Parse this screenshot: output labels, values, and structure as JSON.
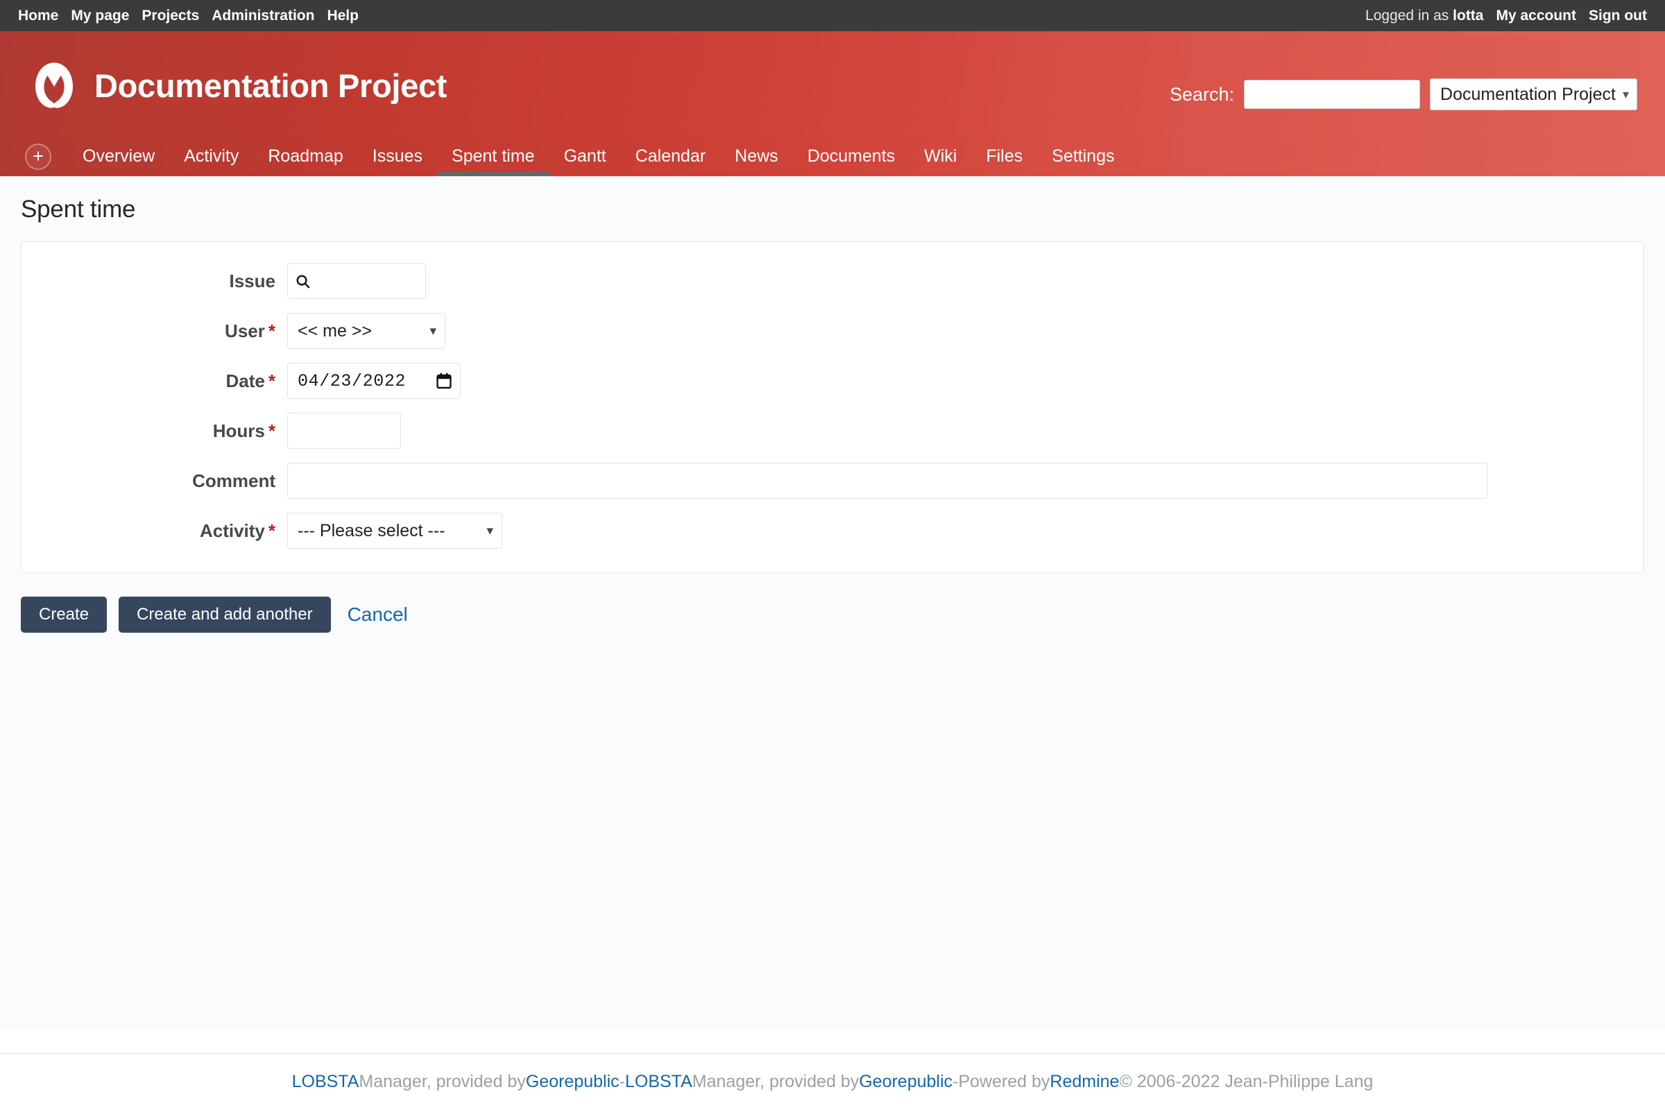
{
  "top_menu": {
    "left_items": [
      {
        "label": "Home",
        "name": "top-menu-home"
      },
      {
        "label": "My page",
        "name": "top-menu-my-page"
      },
      {
        "label": "Projects",
        "name": "top-menu-projects"
      },
      {
        "label": "Administration",
        "name": "top-menu-administration"
      },
      {
        "label": "Help",
        "name": "top-menu-help"
      }
    ],
    "logged_in_prefix": "Logged in as",
    "username": "lotta",
    "my_account": "My account",
    "sign_out": "Sign out"
  },
  "header": {
    "project_title": "Documentation Project",
    "logo_icon": "redmine-m-logo-icon",
    "search_label": "Search:",
    "search_value": "",
    "search_placeholder": "",
    "project_selector_value": "Documentation Project",
    "chevron_icon": "chevron-down-icon"
  },
  "main_menu": {
    "add_button_label": "+",
    "items": [
      {
        "label": "Overview",
        "name": "nav-overview",
        "selected": false
      },
      {
        "label": "Activity",
        "name": "nav-activity",
        "selected": false
      },
      {
        "label": "Roadmap",
        "name": "nav-roadmap",
        "selected": false
      },
      {
        "label": "Issues",
        "name": "nav-issues",
        "selected": false
      },
      {
        "label": "Spent time",
        "name": "nav-spent-time",
        "selected": true
      },
      {
        "label": "Gantt",
        "name": "nav-gantt",
        "selected": false
      },
      {
        "label": "Calendar",
        "name": "nav-calendar",
        "selected": false
      },
      {
        "label": "News",
        "name": "nav-news",
        "selected": false
      },
      {
        "label": "Documents",
        "name": "nav-documents",
        "selected": false
      },
      {
        "label": "Wiki",
        "name": "nav-wiki",
        "selected": false
      },
      {
        "label": "Files",
        "name": "nav-files",
        "selected": false
      },
      {
        "label": "Settings",
        "name": "nav-settings",
        "selected": false
      }
    ]
  },
  "page": {
    "title": "Spent time"
  },
  "form": {
    "issue": {
      "label": "Issue",
      "required": false,
      "value": "",
      "icon": "search-icon"
    },
    "user": {
      "label": "User",
      "required": true,
      "required_mark": "*",
      "value": "<< me >>"
    },
    "date": {
      "label": "Date",
      "required": true,
      "required_mark": "*",
      "value": "04/23/2022",
      "icon": "calendar-icon"
    },
    "hours": {
      "label": "Hours",
      "required": true,
      "required_mark": "*",
      "value": ""
    },
    "comment": {
      "label": "Comment",
      "required": false,
      "value": ""
    },
    "activity": {
      "label": "Activity",
      "required": true,
      "required_mark": "*",
      "value": "--- Please select ---"
    }
  },
  "actions": {
    "create": "Create",
    "create_and_add_another": "Create and add another",
    "cancel": "Cancel"
  },
  "footer": {
    "part1_link": "LOBSTA",
    "part1_text": " Manager, provided by ",
    "part2_link": "Georepublic",
    "dash1": " - ",
    "part3_link": "LOBSTA",
    "part3_text": " Manager, provided by ",
    "part4_link": "Georepublic",
    "dash2": " - ",
    "powered_text": "Powered by ",
    "redmine_link": "Redmine",
    "copyright": " © 2006-2022 Jean-Philippe Lang"
  },
  "colors": {
    "topbar_bg": "#3b3b3b",
    "header_red": "#cf4238",
    "button_navy": "#36465d",
    "link_blue": "#1567a8",
    "required_red": "#b81d1d",
    "active_tab_underline": "#666666"
  }
}
